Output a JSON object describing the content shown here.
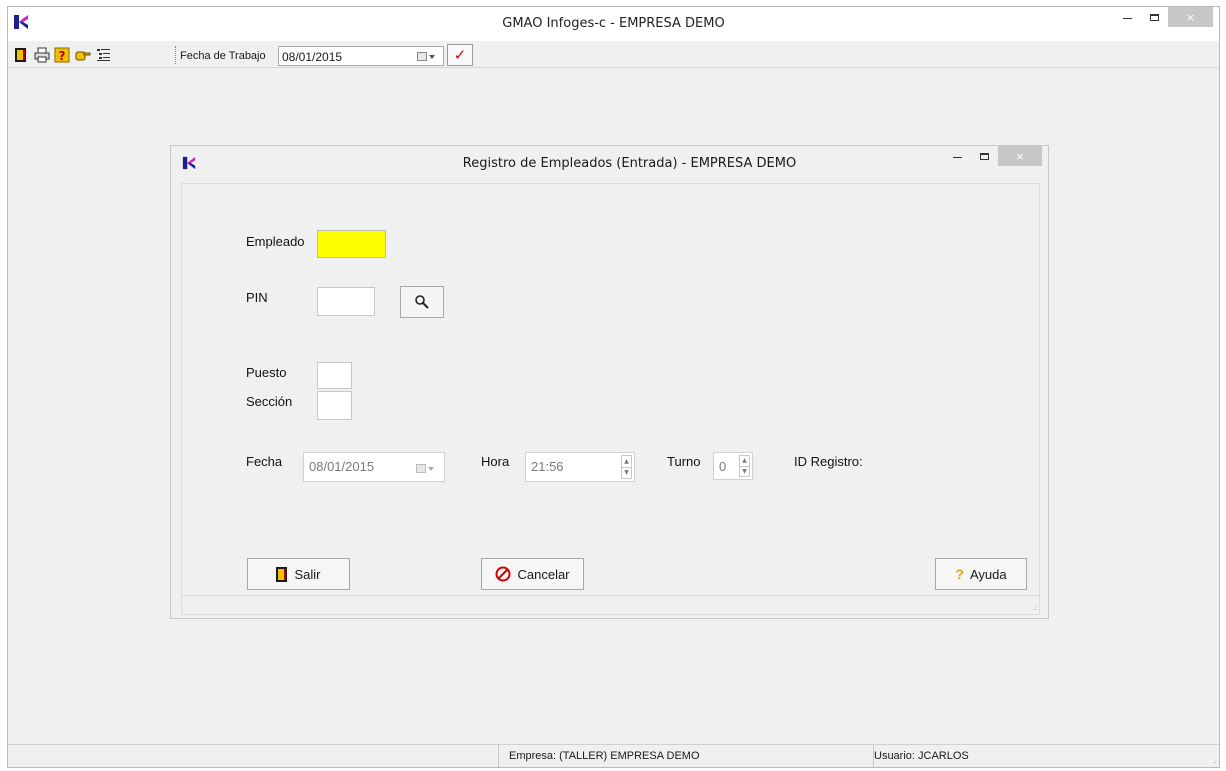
{
  "window": {
    "title": "GMAO Infoges-c - EMPRESA DEMO",
    "close_glyph": "×"
  },
  "toolbar": {
    "icons": [
      "exit-icon",
      "print-icon",
      "help-icon",
      "point-hand-icon",
      "list-icon"
    ],
    "fecha_label": "Fecha de Trabajo",
    "fecha_value": "08/01/2015",
    "confirm_glyph": "✓"
  },
  "dialog": {
    "title": "Registro de Empleados (Entrada) - EMPRESA DEMO",
    "close_glyph": "×",
    "labels": {
      "empleado": "Empleado",
      "pin": "PIN",
      "puesto": "Puesto",
      "seccion": "Sección",
      "fecha": "Fecha",
      "hora": "Hora",
      "turno": "Turno",
      "id_registro": "ID Registro:"
    },
    "values": {
      "empleado": "",
      "pin": "",
      "puesto": "",
      "seccion": "",
      "fecha": "08/01/2015",
      "hora": "21:56",
      "turno": "0"
    },
    "buttons": {
      "salir": "Salir",
      "cancelar": "Cancelar",
      "ayuda": "Ayuda"
    }
  },
  "statusbar": {
    "empresa": "Empresa: (TALLER) EMPRESA DEMO",
    "usuario": "Usuario: JCARLOS"
  },
  "colors": {
    "empleado_highlight": "#ffff00",
    "accent_red": "#d40000",
    "logo_magenta": "#d41fbf",
    "logo_blue": "#1b1f8f"
  }
}
